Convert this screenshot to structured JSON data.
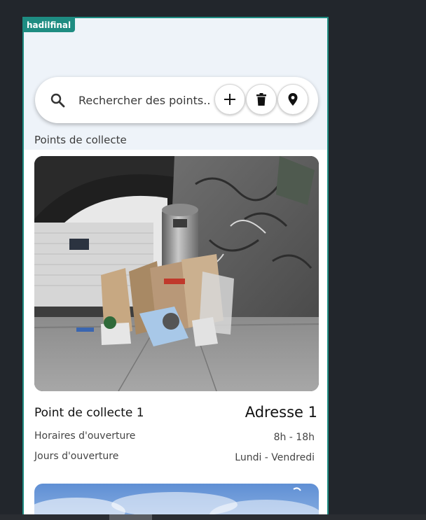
{
  "app": {
    "badge": "hadilfinal"
  },
  "search": {
    "placeholder": "Rechercher des points..."
  },
  "toolbar": {
    "add_icon": "plus-icon",
    "trash_icon": "trash-icon",
    "location_icon": "location-pin-icon"
  },
  "section": {
    "title": "Points de collecte"
  },
  "cards": [
    {
      "title": "Point de collecte 1",
      "address": "Adresse 1",
      "rows": [
        {
          "label": "Horaires d'ouverture",
          "value": "8h - 18h"
        },
        {
          "label": "Jours d'ouverture",
          "value": "Lundi - Vendredi"
        }
      ],
      "image": "photo-trash-bin-graffiti-wall"
    },
    {
      "image": "photo-sky-partial"
    }
  ],
  "colors": {
    "accent": "#1e8c82",
    "background": "#22262c",
    "header_bg": "#eef3f9"
  }
}
